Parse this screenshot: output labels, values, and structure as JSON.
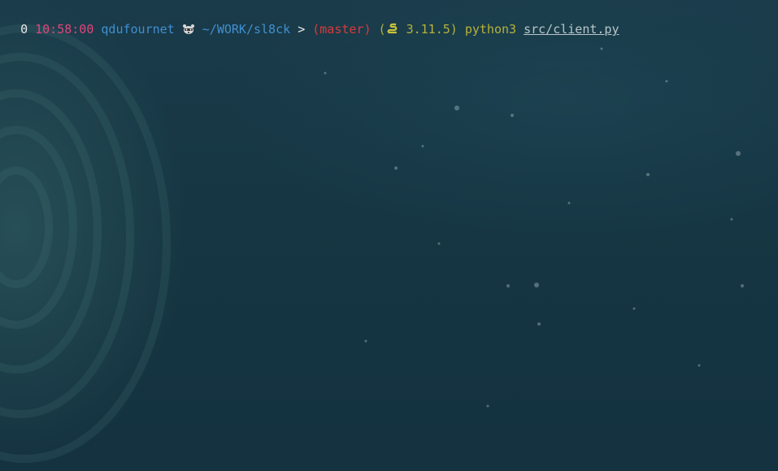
{
  "prompt": {
    "index": "0",
    "time": "10:58:00",
    "user": "qdufournet",
    "host_icon": "raccoon-icon",
    "path": "~/WORK/sl8ck",
    "separator": ">",
    "branch": "(master)",
    "python_open": "(",
    "python_icon": "python-snake-icon",
    "python_version": "3.11.5)",
    "command": "python3",
    "argument": "src/client.py"
  },
  "colors": {
    "background": "#163844",
    "time": "#e0457b",
    "user_path": "#3f8fd0",
    "branch": "#d93a3a",
    "python": "#b5b23a",
    "argument": "#b9c6c9"
  }
}
